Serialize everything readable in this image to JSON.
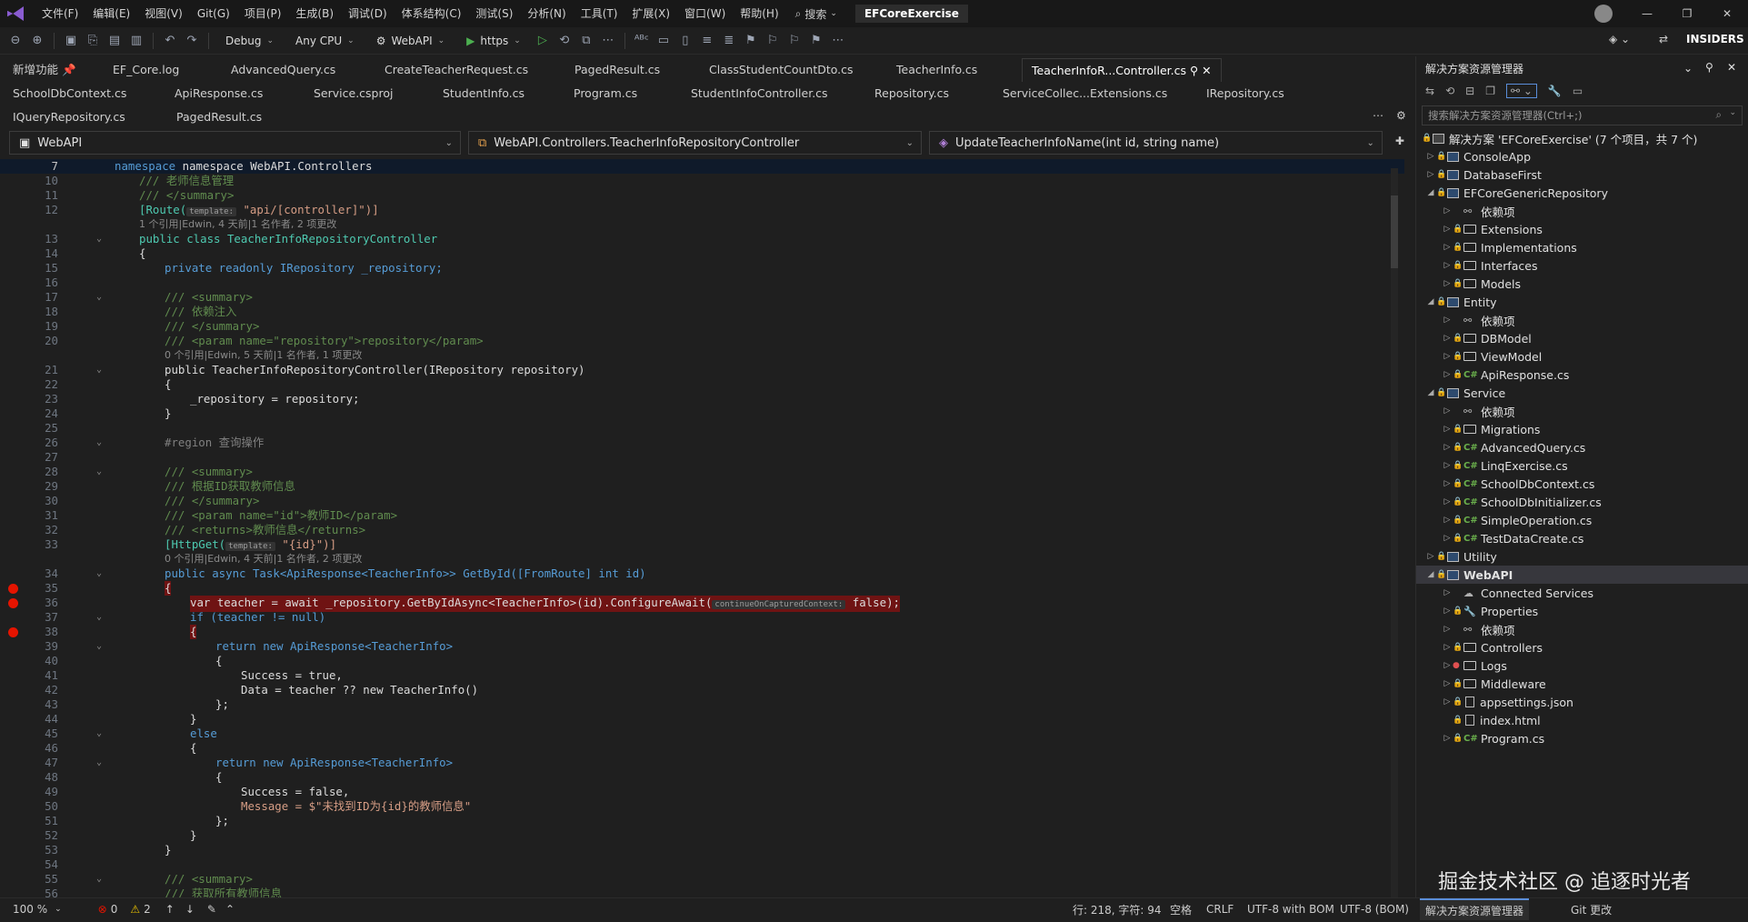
{
  "menu": {
    "items": [
      "文件(F)",
      "编辑(E)",
      "视图(V)",
      "Git(G)",
      "项目(P)",
      "生成(B)",
      "调试(D)",
      "体系结构(C)",
      "测试(S)",
      "分析(N)",
      "工具(T)",
      "扩展(X)",
      "窗口(W)",
      "帮助(H)"
    ],
    "search_label": "搜索",
    "solution_name": "EFCoreExercise"
  },
  "toolbar": {
    "config": "Debug",
    "platform": "Any CPU",
    "startup": "WebAPI",
    "run_label": "https",
    "insiders": "INSIDERS"
  },
  "tabs": {
    "row1": [
      "新增功能",
      "EF_Core.log",
      "AdvancedQuery.cs",
      "CreateTeacherRequest.cs",
      "PagedResult.cs",
      "ClassStudentCountDto.cs",
      "TeacherInfo.cs",
      "TeacherInfoR...Controller.cs"
    ],
    "row2": [
      "SchoolDbContext.cs",
      "ApiResponse.cs",
      "Service.csproj",
      "StudentInfo.cs",
      "Program.cs",
      "StudentInfoController.cs",
      "Repository.cs",
      "ServiceCollec...Extensions.cs",
      "IRepository.cs"
    ],
    "row3": [
      "IQueryRepository.cs",
      "PagedResult.cs"
    ]
  },
  "nav": {
    "project": "WebAPI",
    "class": "WebAPI.Controllers.TeacherInfoRepositoryController",
    "member": "UpdateTeacherInfoName(int id, string name)"
  },
  "code": {
    "l7": "namespace WebAPI.Controllers",
    "l10": "/// 老师信息管理",
    "l11": "/// </summary>",
    "l12a": "[Route(",
    "l12h": "template:",
    "l12b": "\"api/[controller]\")]",
    "h12": "1 个引用|Edwin, 4 天前|1 名作者, 2 项更改",
    "l13": "public class TeacherInfoRepositoryController",
    "l14": "{",
    "l15": "private readonly IRepository _repository;",
    "l17": "/// <summary>",
    "l18": "/// 依赖注入",
    "l19": "/// </summary>",
    "l20": "/// <param name=\"repository\">repository</param>",
    "h20": "0 个引用|Edwin, 5 天前|1 名作者, 1 项更改",
    "l21": "public TeacherInfoRepositoryController(IRepository repository)",
    "l22": "{",
    "l23": "_repository = repository;",
    "l24": "}",
    "l26": "#region 查询操作",
    "l28": "/// <summary>",
    "l29": "/// 根据ID获取教师信息",
    "l30": "/// </summary>",
    "l31": "/// <param name=\"id\">教师ID</param>",
    "l32": "/// <returns>教师信息</returns>",
    "l33a": "[HttpGet(",
    "l33h": "template:",
    "l33b": "\"{id}\")]",
    "h33": "0 个引用|Edwin, 4 天前|1 名作者, 2 项更改",
    "l34": "public async Task<ApiResponse<TeacherInfo>> GetById([FromRoute] int id)",
    "l35": "{",
    "l36a": "var teacher = await _repository.GetByIdAsync<TeacherInfo>(id).ConfigureAwait(",
    "l36h": "continueOnCapturedContext:",
    "l36b": "false);",
    "l37": "if (teacher != null)",
    "l38": "{",
    "l39": "return new ApiResponse<TeacherInfo>",
    "l40": "{",
    "l41": "Success = true,",
    "l42": "Data = teacher ?? new TeacherInfo()",
    "l43": "};",
    "l44": "}",
    "l45": "else",
    "l46": "{",
    "l47": "return new ApiResponse<TeacherInfo>",
    "l48": "{",
    "l49": "Success = false,",
    "l50": "Message = $\"未找到ID为{id}的教师信息\"",
    "l51": "};",
    "l52": "}",
    "l53": "}",
    "l55": "/// <summary>",
    "l56": "/// 获取所有教师信息"
  },
  "status": {
    "zoom": "100 %",
    "errors": "0",
    "warnings": "2",
    "position": "行: 218, 字符: 94",
    "spaces": "空格",
    "eol": "CRLF",
    "encoding1": "UTF-8 with BOM",
    "encoding2": "UTF-8 (BOM)",
    "tab_se": "解决方案资源管理器",
    "tab_git": "Git 更改"
  },
  "solution_explorer": {
    "title": "解决方案资源管理器",
    "search_placeholder": "搜索解决方案资源管理器(Ctrl+;)",
    "nodes": [
      "解决方案 'EFCoreExercise' (7 个项目，共 7 个)",
      "ConsoleApp",
      "DatabaseFirst",
      "EFCoreGenericRepository",
      "依赖项",
      "Extensions",
      "Implementations",
      "Interfaces",
      "Models",
      "Entity",
      "依赖项",
      "DBModel",
      "ViewModel",
      "ApiResponse.cs",
      "Service",
      "依赖项",
      "Migrations",
      "AdvancedQuery.cs",
      "LinqExercise.cs",
      "SchoolDbContext.cs",
      "SchoolDbInitializer.cs",
      "SimpleOperation.cs",
      "TestDataCreate.cs",
      "Utility",
      "WebAPI",
      "Connected Services",
      "Properties",
      "依赖项",
      "Controllers",
      "Logs",
      "Middleware",
      "appsettings.json",
      "index.html",
      "Program.cs"
    ]
  },
  "watermark": "掘金技术社区 @ 追逐时光者"
}
